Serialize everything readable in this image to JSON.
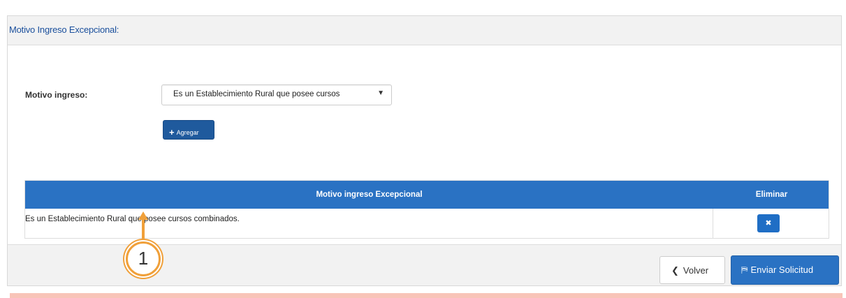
{
  "panel": {
    "title": "Motivo Ingreso Excepcional:"
  },
  "form": {
    "motivo_label": "Motivo ingreso:",
    "motivo_select_value": "Es un Establecimiento Rural que posee cursos",
    "add_button_label": "Agregar"
  },
  "table": {
    "columns": [
      "Motivo ingreso Excepcional",
      "Eliminar"
    ],
    "rows": [
      {
        "motivo": "Es un Establecimiento Rural que posee cursos combinados."
      }
    ]
  },
  "annotation": {
    "number": "1"
  },
  "footer": {
    "back_label": "Volver",
    "submit_label": "Enviar Solicitud"
  },
  "icons": {
    "add": "plus-icon",
    "delete": "close-icon",
    "back": "chevron-left-icon",
    "submit": "send-icon",
    "select": "caret-down-icon"
  },
  "colors": {
    "primary": "#2a72c3",
    "dark_primary": "#1f5a9d",
    "title_text": "#1a4f9c",
    "annotation": "#f0a03a",
    "alert_bar": "#f8c4b8"
  }
}
